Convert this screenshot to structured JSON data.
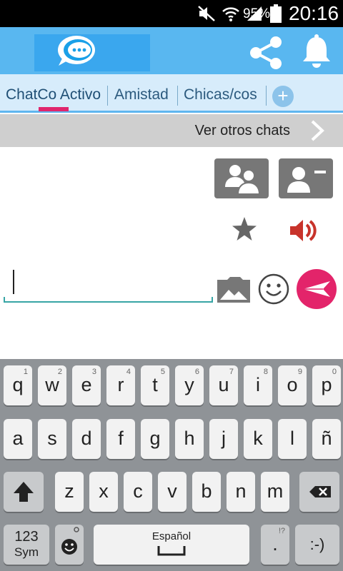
{
  "status_bar": {
    "battery_percent": "95%",
    "time": "20:16",
    "icons": [
      "mute-icon",
      "wifi-icon",
      "signal-icon",
      "battery-icon"
    ]
  },
  "app_bar": {
    "logo_icon": "chat-bubble-logo-icon",
    "share_icon": "share-icon",
    "bell_icon": "bell-icon"
  },
  "tabs": [
    {
      "label": "ChatCo Activo",
      "active": true
    },
    {
      "label": "Amistad",
      "active": false
    },
    {
      "label": "Chicas/cos",
      "active": false
    }
  ],
  "tabs_add_label": "+",
  "other_chats": {
    "label": "Ver otros chats",
    "icon": "chevron-right-icon"
  },
  "actions": {
    "group_icon": "group-users-icon",
    "contact_icon": "contact-remove-icon",
    "star_icon": "star-icon",
    "speaker_icon": "speaker-icon"
  },
  "composer": {
    "value": "",
    "gallery_icon": "image-gallery-icon",
    "emoji_icon": "smiley-icon",
    "send_icon": "send-icon"
  },
  "keyboard": {
    "row1": [
      {
        "key": "q",
        "hint": "1"
      },
      {
        "key": "w",
        "hint": "2"
      },
      {
        "key": "e",
        "hint": "3"
      },
      {
        "key": "r",
        "hint": "4"
      },
      {
        "key": "t",
        "hint": "5"
      },
      {
        "key": "y",
        "hint": "6"
      },
      {
        "key": "u",
        "hint": "7"
      },
      {
        "key": "i",
        "hint": "8"
      },
      {
        "key": "o",
        "hint": "9"
      },
      {
        "key": "p",
        "hint": "0"
      }
    ],
    "row2": [
      "a",
      "s",
      "d",
      "f",
      "g",
      "h",
      "j",
      "k",
      "l",
      "ñ"
    ],
    "row3": [
      "z",
      "x",
      "c",
      "v",
      "b",
      "n",
      "m"
    ],
    "sym_label": "123",
    "sym_sub": "Sym",
    "space_label": "Español",
    "period_label": ".",
    "period_hint": "!?",
    "emoticon_label": ":-)",
    "shift_icon": "shift-arrow-icon",
    "backspace_icon": "backspace-icon",
    "emoji_key_icon": "emoji-key-icon"
  }
}
